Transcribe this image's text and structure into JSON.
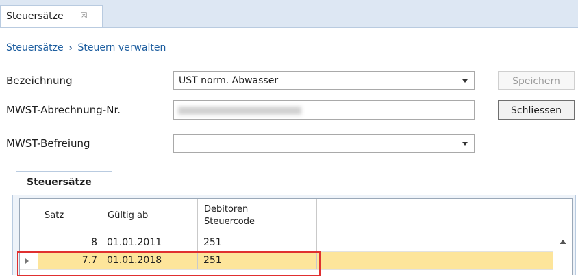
{
  "window": {
    "tab_label": "Steuersätze",
    "tab_close_glyph": "☒"
  },
  "breadcrumb": {
    "items": [
      "Steuersätze",
      "Steuern verwalten"
    ],
    "separator": "›"
  },
  "form": {
    "bezeichnung": {
      "label": "Bezeichnung",
      "value": "UST norm. Abwasser"
    },
    "mwst_nr": {
      "label": "MWST-Abrechnung-Nr.",
      "value": ""
    },
    "befreiung": {
      "label": "MWST-Befreiung",
      "value": ""
    }
  },
  "buttons": {
    "save": "Speichern",
    "close": "Schliessen"
  },
  "inner_tab": "Steuersätze",
  "table": {
    "columns": [
      "Satz",
      "Gültig ab",
      "Debitoren",
      "Steuercode"
    ],
    "rows": [
      {
        "satz": "8",
        "gueltig_ab": "01.01.2011",
        "code": "251"
      },
      {
        "satz": "7.7",
        "gueltig_ab": "01.01.2018",
        "code": "251"
      }
    ]
  },
  "colors": {
    "selection": "#fde59b",
    "highlight_border": "#e03030",
    "link": "#1f5fa0"
  }
}
